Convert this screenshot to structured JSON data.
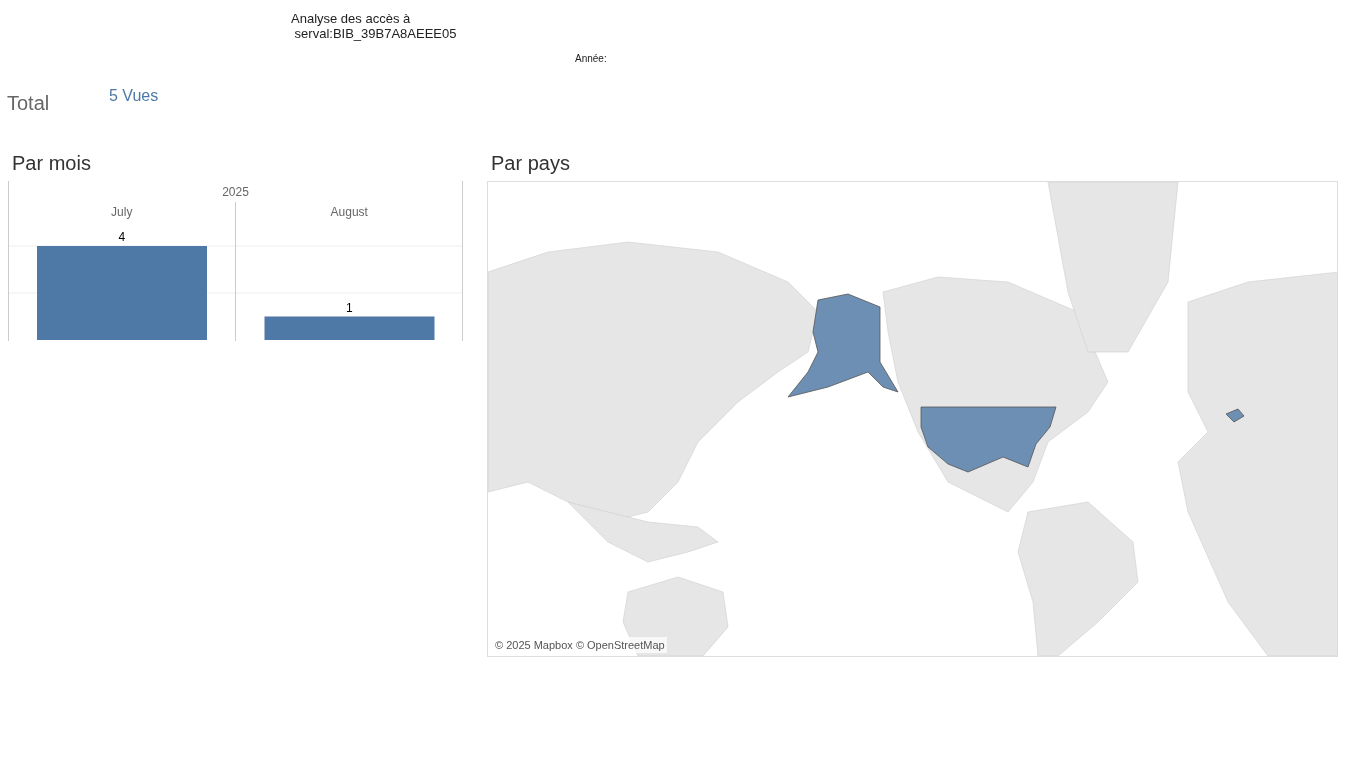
{
  "header": {
    "title_lines": [
      "Analyse des accès à",
      "serval:BIB_39B7A8AEEE05"
    ],
    "year_filter_label": "Année:"
  },
  "total": {
    "label": "Total",
    "value": "5 Vues"
  },
  "by_month": {
    "title": "Par mois",
    "chart_data": {
      "type": "bar",
      "title": "2025",
      "categories": [
        "July",
        "August"
      ],
      "series": [
        {
          "color": "#4e79a7",
          "values": [
            4,
            1
          ]
        }
      ],
      "ylim": [
        0,
        4
      ],
      "ref_lines": [
        {
          "axis": "y",
          "value": 2
        }
      ],
      "data_labels": true
    }
  },
  "by_country": {
    "title": "Par pays",
    "attribution": "© 2025 Mapbox © OpenStreetMap"
  }
}
